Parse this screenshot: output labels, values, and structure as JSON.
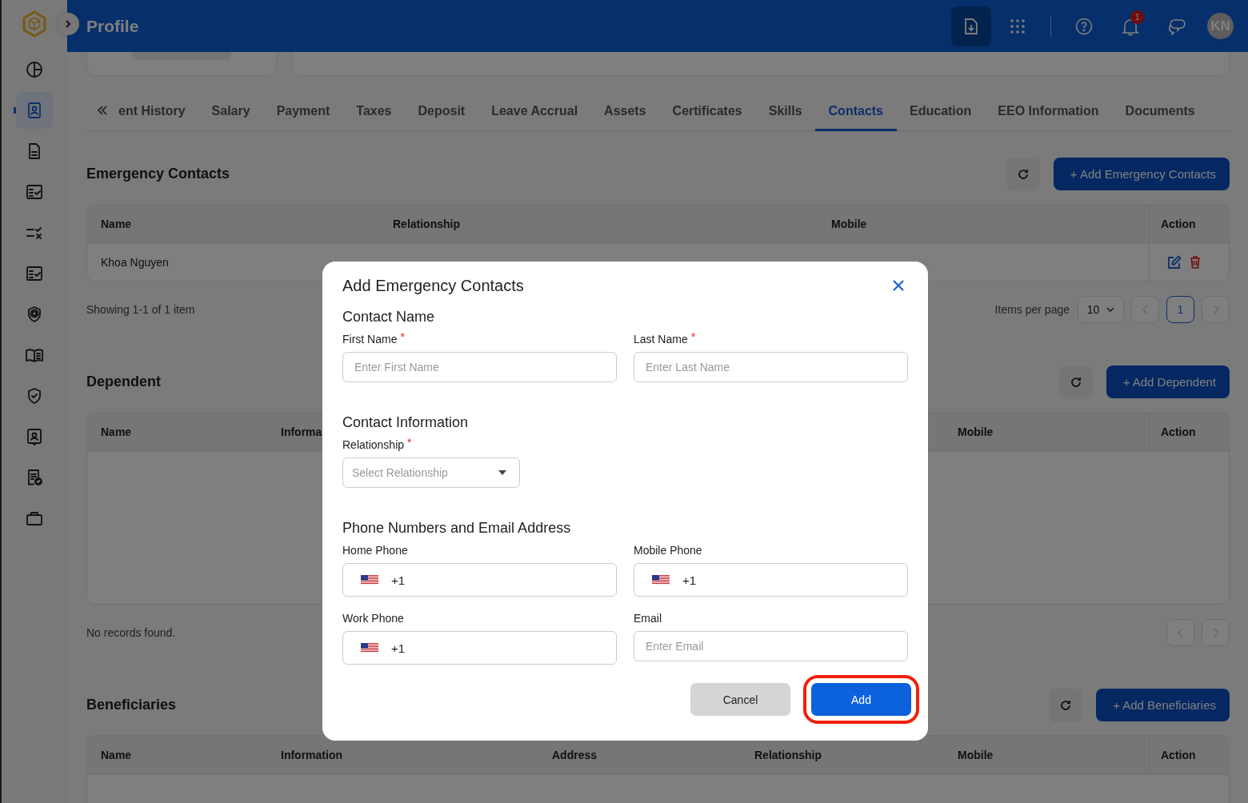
{
  "app": {
    "title": "Profile",
    "notification_count": "1",
    "avatar_initials": "KN"
  },
  "sidebar": [
    {
      "kind": "pie",
      "selected": false
    },
    {
      "kind": "contact",
      "selected": true
    },
    {
      "kind": "document",
      "selected": false
    },
    {
      "kind": "checklist",
      "selected": false
    },
    {
      "kind": "tasks",
      "selected": false
    },
    {
      "kind": "checklist",
      "selected": false
    },
    {
      "kind": "shield-at",
      "selected": false
    },
    {
      "kind": "book",
      "selected": false
    },
    {
      "kind": "shield-check",
      "selected": false
    },
    {
      "kind": "badge",
      "selected": false
    },
    {
      "kind": "receipt",
      "selected": false
    },
    {
      "kind": "briefcase",
      "selected": false
    }
  ],
  "tabs": [
    {
      "label": "ent History",
      "selected": false
    },
    {
      "label": "Salary",
      "selected": false
    },
    {
      "label": "Payment",
      "selected": false
    },
    {
      "label": "Taxes",
      "selected": false
    },
    {
      "label": "Deposit",
      "selected": false
    },
    {
      "label": "Leave Accrual",
      "selected": false
    },
    {
      "label": "Assets",
      "selected": false
    },
    {
      "label": "Certificates",
      "selected": false
    },
    {
      "label": "Skills",
      "selected": false
    },
    {
      "label": "Contacts",
      "selected": true
    },
    {
      "label": "Education",
      "selected": false
    },
    {
      "label": "EEO Information",
      "selected": false
    },
    {
      "label": "Documents",
      "selected": false
    }
  ],
  "sections": [
    {
      "kind": "compact",
      "title": "Emergency Contacts",
      "add_button": "+ Add Emergency Contacts",
      "columns": [
        "Name",
        "Relationship",
        "Mobile",
        "Action"
      ],
      "rows": [
        {
          "cells": [
            "Khoa Nguyen"
          ]
        }
      ],
      "footer": {
        "summary": "Showing 1-1 of 1 item",
        "per_page_label": "Items per page",
        "per_page": "10",
        "prev_disabled": true,
        "next_disabled": true,
        "pages": [
          {
            "label": "1",
            "selected": true
          }
        ]
      }
    },
    {
      "kind": "wide",
      "title": "Dependent",
      "add_button": "+ Add Dependent",
      "columns": [
        "Name",
        "Informa",
        "Mobile",
        "Action"
      ],
      "footer": {
        "summary": "No records found.",
        "prev_disabled": true,
        "next_disabled": true
      }
    },
    {
      "kind": "wide",
      "title": "Beneficiaries",
      "add_button": "+ Add Beneficiaries",
      "columns": [
        "Name",
        "Information",
        "Address",
        "Relationship",
        "Mobile",
        "Action"
      ]
    }
  ],
  "modal": {
    "title": "Add Emergency Contacts",
    "groups": [
      {
        "heading": "Contact Name",
        "fields": [
          {
            "kind": "text",
            "label": "First Name",
            "required_mark": "*",
            "placeholder": "Enter First Name"
          },
          {
            "kind": "text",
            "label": "Last Name",
            "required_mark": "*",
            "placeholder": "Enter Last Name"
          }
        ]
      },
      {
        "heading": "Contact Information",
        "fields": [
          {
            "kind": "select",
            "label": "Relationship",
            "required_mark": "*",
            "placeholder": "Select Relationship"
          }
        ]
      },
      {
        "heading": "Phone Numbers and Email Address",
        "fields": [
          {
            "kind": "phone",
            "label": "Home Phone",
            "value": "+1"
          },
          {
            "kind": "phone",
            "label": "Mobile Phone",
            "value": "+1"
          },
          {
            "kind": "phone",
            "label": "Work Phone",
            "value": "+1"
          },
          {
            "kind": "text",
            "label": "Email",
            "placeholder": "Enter Email"
          }
        ]
      }
    ],
    "buttons": [
      {
        "kind": "secondary",
        "label": "Cancel"
      },
      {
        "kind": "primary",
        "label": "Add",
        "highlighted": true
      }
    ]
  }
}
